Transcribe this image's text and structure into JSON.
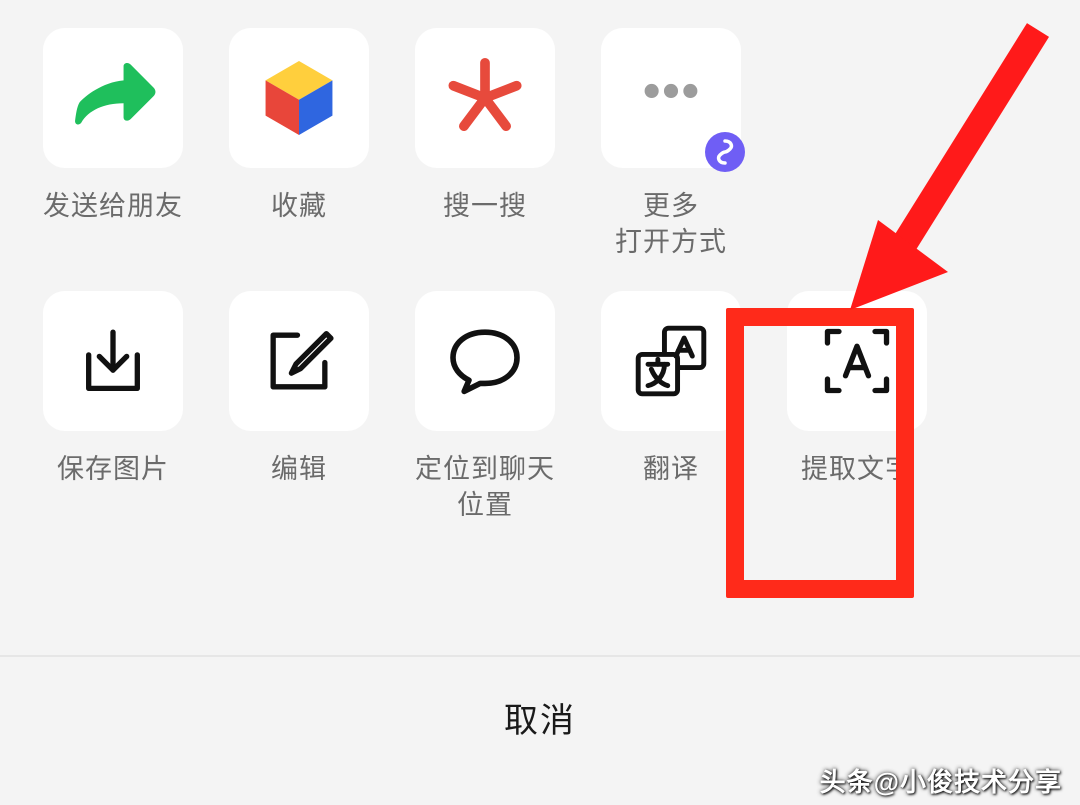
{
  "row1": [
    {
      "label": "发送给朋友"
    },
    {
      "label": "收藏"
    },
    {
      "label": "搜一搜"
    },
    {
      "label": "更多\n打开方式"
    }
  ],
  "row2": [
    {
      "label": "保存图片"
    },
    {
      "label": "编辑"
    },
    {
      "label": "定位到聊天\n位置"
    },
    {
      "label": "翻译"
    },
    {
      "label": "提取文字"
    }
  ],
  "cancel": "取消",
  "watermark": "头条@小俊技术分享"
}
